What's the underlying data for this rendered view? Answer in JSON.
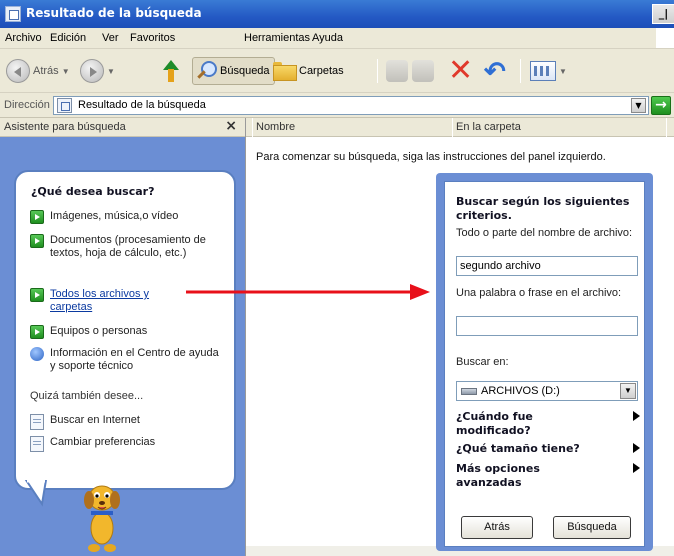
{
  "window": {
    "title": "Resultado de la búsqueda",
    "control_glyph": "_|"
  },
  "menu": {
    "items": [
      "Archivo",
      "Edición",
      "Ver",
      "Favoritos",
      "Herramientas",
      "Ayuda"
    ]
  },
  "toolbar": {
    "back_label": "Atrás",
    "search_label": "Búsqueda",
    "folders_label": "Carpetas"
  },
  "address": {
    "label": "Dirección",
    "value": "Resultado de la búsqueda"
  },
  "left_pane": {
    "header": "Asistente para búsqueda",
    "close_glyph": "×",
    "question": "¿Qué desea buscar?",
    "options": [
      {
        "label": "Imágenes, música,o vídeo"
      },
      {
        "label": "Documentos (procesamiento de textos, hoja de cálculo, etc.)"
      },
      {
        "label": "Todos los archivos y carpetas"
      },
      {
        "label": "Equipos o personas"
      },
      {
        "label": "Información en el Centro de ayuda y soporte técnico"
      }
    ],
    "also_title": "Quizá también desee...",
    "extra": [
      {
        "label": "Buscar en Internet"
      },
      {
        "label": "Cambiar preferencias"
      }
    ]
  },
  "results": {
    "columns": [
      "Nombre",
      "En la carpeta"
    ],
    "instructions": "Para comenzar su búsqueda, siga las instrucciones del panel izquierdo."
  },
  "criteria": {
    "title": "Buscar según los siguientes criterios.",
    "filename_label": "Todo o parte del nombre de archivo:",
    "filename_value": "segundo archivo",
    "phrase_label": "Una palabra o frase en el archivo:",
    "phrase_value": "",
    "look_in_label": "Buscar en:",
    "look_in_value": "ARCHIVOS (D:)",
    "expanders": [
      "¿Cuándo fue modificado?",
      "¿Qué tamaño tiene?",
      "Más opciones avanzadas"
    ],
    "back_button": "Atrás",
    "search_button": "Búsqueda"
  },
  "colors": {
    "pane_blue": "#6b8ed4",
    "arrow_red": "#e8101a",
    "titlebar_blue": "#2459c4"
  }
}
